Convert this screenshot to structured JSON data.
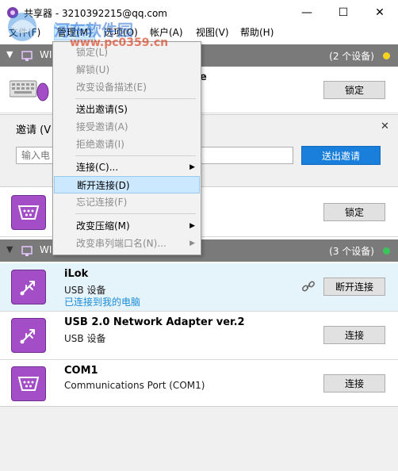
{
  "window": {
    "title": "共享器 - 3210392215@qq.com",
    "minimize": "—",
    "maximize": "☐",
    "close": "✕"
  },
  "menubar": {
    "items": [
      "文件(F)",
      "管理(M)",
      "选项(O)",
      "帐户(A)",
      "视图(V)",
      "帮助(H)"
    ]
  },
  "watermark": {
    "line1": "河东软件园",
    "line2": "www.pc0359.cn"
  },
  "groups": [
    {
      "name": "WI",
      "count": "(2 个设备)",
      "dot_color": "#f5d21f"
    },
    {
      "name": "WI",
      "count": "(3 个设备)",
      "dot_color": "#3cc45a"
    }
  ],
  "local_devices": [
    {
      "name_tail": "e",
      "button": "锁定",
      "icon": "keyboard-mouse-icon"
    },
    {
      "button": "锁定",
      "icon": "serial-port-icon"
    }
  ],
  "invite": {
    "title": "邀请 (V",
    "placeholder": "输入电",
    "send_label": "送出邀请",
    "close": "✕"
  },
  "remote_devices": [
    {
      "name": "iLok",
      "type": "USB 设备",
      "status": "已连接到我的电脑",
      "button": "断开连接",
      "icon": "usb-icon"
    },
    {
      "name": "USB 2.0 Network Adapter ver.2",
      "type": "USB 设备",
      "status": "",
      "button": "连接",
      "icon": "usb-icon"
    },
    {
      "name": "COM1",
      "type": "Communications Port (COM1)",
      "status": "",
      "button": "连接",
      "icon": "serial-port-icon"
    }
  ],
  "dropdown": {
    "items": [
      {
        "label": "锁定(L)",
        "disabled": true
      },
      {
        "label": "解锁(U)",
        "disabled": true
      },
      {
        "label": "改变设备描述(E)",
        "disabled": true
      },
      {
        "label": "送出邀请(S)",
        "disabled": false
      },
      {
        "label": "接受邀请(A)",
        "disabled": true
      },
      {
        "label": "拒绝邀请(I)",
        "disabled": true
      },
      {
        "label": "连接(C)...",
        "disabled": false,
        "submenu": true
      },
      {
        "label": "断开连接(D)",
        "disabled": false,
        "hover": true
      },
      {
        "label": "忘记连接(F)",
        "disabled": true
      },
      {
        "label": "改变压缩(M)",
        "disabled": false,
        "submenu": true
      },
      {
        "label": "改变串列端口名(N)...",
        "disabled": true,
        "submenu": true
      }
    ]
  },
  "colors": {
    "group_header": "#7a7a7a",
    "accent": "#1a7fdb",
    "device_icon": "#a34ec6",
    "link_blue": "#1a8cd8"
  }
}
